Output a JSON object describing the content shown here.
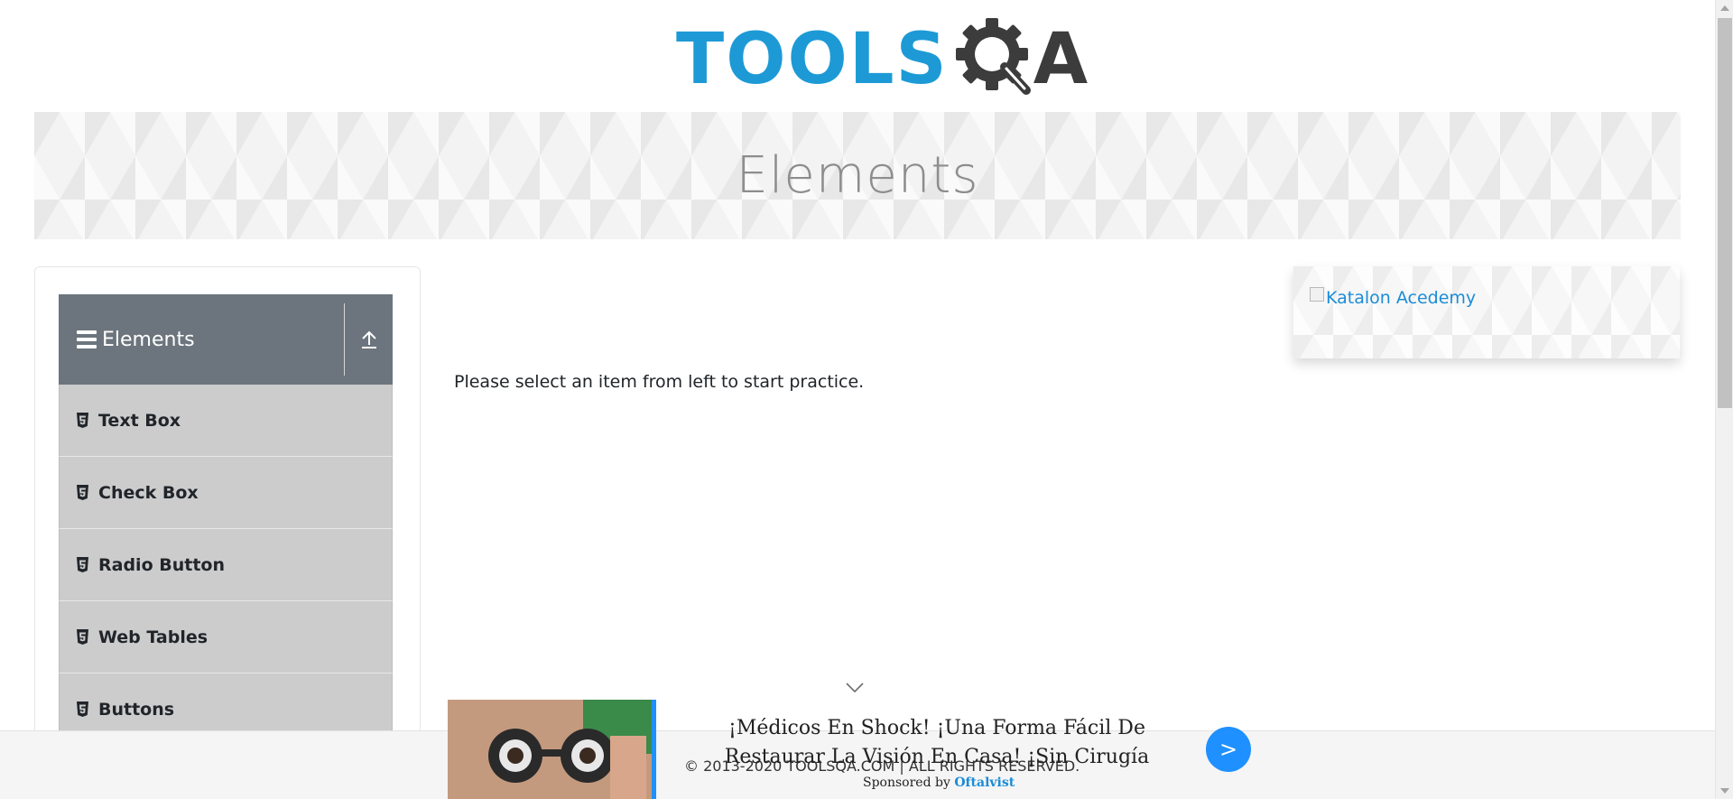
{
  "header": {
    "logo_tools": "TOOLS",
    "logo_a": "A"
  },
  "banner": {
    "title": "Elements"
  },
  "sidebar": {
    "group_title": "Elements",
    "items": [
      {
        "label": "Text Box",
        "icon": "html5-icon"
      },
      {
        "label": "Check Box",
        "icon": "html5-icon"
      },
      {
        "label": "Radio Button",
        "icon": "html5-icon"
      },
      {
        "label": "Web Tables",
        "icon": "html5-icon"
      },
      {
        "label": "Buttons",
        "icon": "html5-icon"
      }
    ]
  },
  "main": {
    "instruction": "Please select an item from left to start practice."
  },
  "right_ad": {
    "alt_text": "Katalon Acedemy"
  },
  "footer": {
    "copyright": "© 2013-2020 TOOLSQA.COM | ALL RIGHTS RESERVED."
  },
  "sponsored": {
    "headline": "¡Médicos En Shock! ¡Una Forma Fácil De Restaurar La Visión En Casa! ¡Sin Cirugía",
    "go_label": ">",
    "sponsored_by": "Sponsored by",
    "brand": "Oftalvist"
  },
  "colors": {
    "logo_blue": "#1d9ad6",
    "logo_dark": "#3c3c3c",
    "group_header_bg": "#6c757d",
    "menu_item_bg": "#cccccc",
    "accent_blue": "#1e90ff"
  }
}
